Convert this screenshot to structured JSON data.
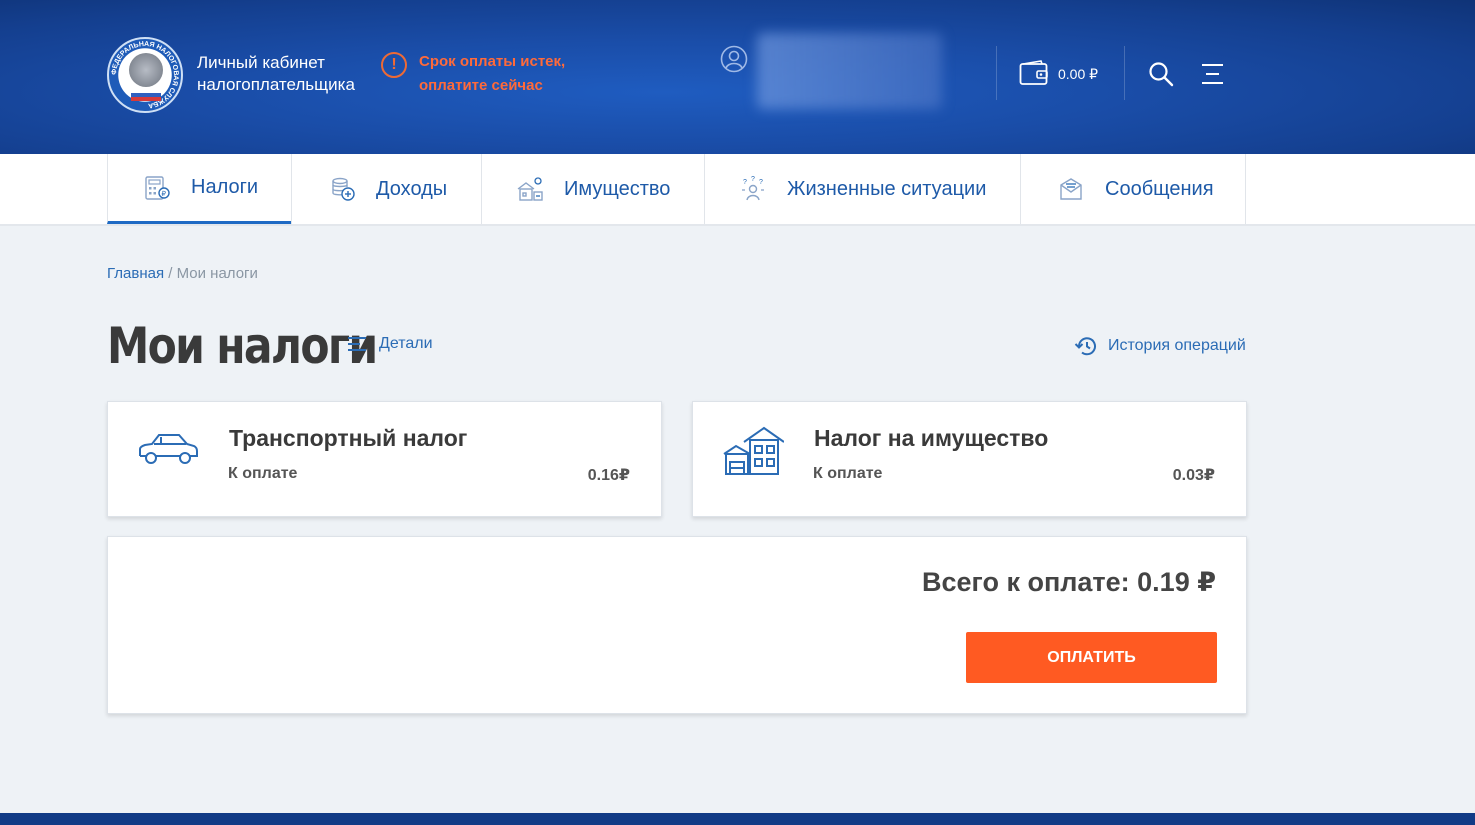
{
  "header": {
    "brand": "Личный кабинет налогоплательщика",
    "alert": "Срок оплаты истек, оплатите сейчас",
    "balance": "0.00 ₽",
    "logo_ring_text": "ФЕДЕРАЛЬНАЯ НАЛОГОВАЯ СЛУЖБА"
  },
  "nav": {
    "tabs": [
      {
        "label": "Налоги",
        "icon": "calculator-icon",
        "active": true
      },
      {
        "label": "Доходы",
        "icon": "coins-icon",
        "active": false
      },
      {
        "label": "Имущество",
        "icon": "property-icon",
        "active": false
      },
      {
        "label": "Жизненные ситуации",
        "icon": "life-situations-icon",
        "active": false
      },
      {
        "label": "Сообщения",
        "icon": "messages-icon",
        "active": false
      }
    ]
  },
  "breadcrumb": {
    "home": "Главная",
    "separator": " / ",
    "current": "Мои налоги"
  },
  "page": {
    "title": "Мои налоги",
    "details": "Детали",
    "history": "История операций"
  },
  "cards": [
    {
      "title": "Транспортный налог",
      "sub": "К оплате",
      "amount": "0.16₽",
      "icon": "car-icon"
    },
    {
      "title": "Налог на имущество",
      "sub": "К оплате",
      "amount": "0.03₽",
      "icon": "house-icon"
    }
  ],
  "total": {
    "text": "Всего к оплате: 0.19 ₽",
    "pay_button": "ОПЛАТИТЬ"
  },
  "colors": {
    "header_blue": "#1a4da8",
    "accent_blue": "#1e5aa8",
    "alert_orange": "#ff6a3a",
    "pay_orange": "#ff5a22"
  }
}
